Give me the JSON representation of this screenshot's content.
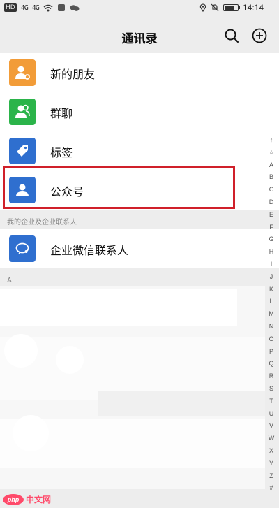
{
  "status_bar": {
    "left_chip": "HD",
    "signal_a": "4G",
    "signal_b": "4G",
    "time": "14:14",
    "battery_level": 0.7
  },
  "header": {
    "title": "通讯录",
    "search_icon": "search-icon",
    "add_icon": "plus-circle-icon"
  },
  "menu_items": [
    {
      "label": "新的朋友",
      "icon": "add-friend-icon",
      "color": "#f29c38"
    },
    {
      "label": "群聊",
      "icon": "group-chat-icon",
      "color": "#2bb44a"
    },
    {
      "label": "标签",
      "icon": "tag-icon",
      "color": "#2f6fcf"
    },
    {
      "label": "公众号",
      "icon": "official-account-icon",
      "color": "#2f6fcf"
    }
  ],
  "enterprise": {
    "section_title": "我的企业及企业联系人",
    "item_label": "企业微信联系人",
    "item_icon": "enterprise-contact-icon",
    "item_color": "#2f6fcf"
  },
  "contacts_section": {
    "letter": "A"
  },
  "alphabet_index": [
    "↑",
    "☆",
    "A",
    "B",
    "C",
    "D",
    "E",
    "F",
    "G",
    "H",
    "I",
    "J",
    "K",
    "L",
    "M",
    "N",
    "O",
    "P",
    "Q",
    "R",
    "S",
    "T",
    "U",
    "V",
    "W",
    "X",
    "Y",
    "Z",
    "#"
  ],
  "watermark": {
    "logo": "php",
    "text": "中文网"
  },
  "colors": {
    "highlight": "#d0202a",
    "background": "#ededed"
  }
}
